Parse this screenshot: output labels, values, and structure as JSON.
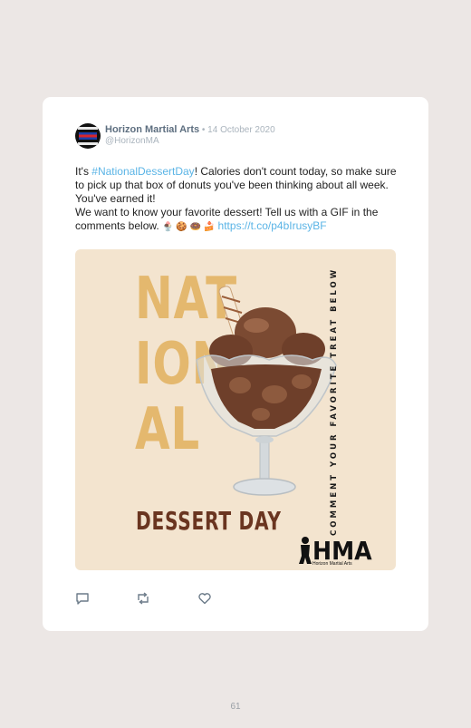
{
  "post": {
    "author_name": "Horizon Martial Arts",
    "separator": " • ",
    "date": "14 October 2020",
    "handle": "@HorizonMA",
    "text_part1": "It's ",
    "hashtag": "#NationalDessertDay",
    "text_part2": "! Calories don't count today, so make sure to pick up that box of donuts you've been thinking about all week. You've earned it!",
    "text_line2": "We want to know your favorite dessert! Tell us with a GIF in the comments below.",
    "emojis": "🍨 🍪 🍩 🍰",
    "link": "https://t.co/p4bIrusyBF"
  },
  "media": {
    "line1": "NAT",
    "line2": "ION",
    "line3": "AL",
    "subtitle": "DESSERT DAY",
    "vertical_text": "COMMENT YOUR FAVORITE TREAT BELOW",
    "logo_text": "HMA",
    "logo_subtext": "Horizon Martial Arts",
    "colors": {
      "background": "#f3e4cf",
      "headline": "#e4b86e",
      "subtitle": "#6a3520"
    }
  },
  "actions": [
    "comment-icon",
    "retweet-icon",
    "like-icon"
  ],
  "page_number": "61"
}
